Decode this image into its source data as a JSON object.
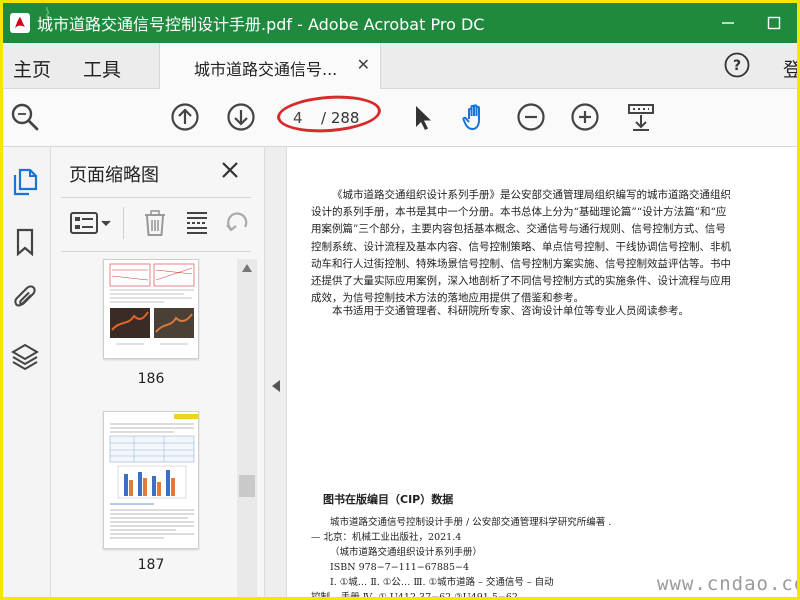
{
  "window": {
    "title": "城市道路交通信号控制设计手册.pdf - Adobe Acrobat Pro DC",
    "accent": "#1f8a3e"
  },
  "tabs": {
    "home": "主页",
    "tools": "工具",
    "document": "城市道路交通信号...",
    "login": "登"
  },
  "toolbar": {
    "page_current": "4",
    "page_total": "/ 288",
    "highlight_color": "#d52b2b"
  },
  "thumbnails": {
    "panel_title": "页面缩略图",
    "pages": [
      {
        "number": "186"
      },
      {
        "number": "187"
      }
    ]
  },
  "document": {
    "paragraph1": "《城市道路交通组织设计系列手册》是公安部交通管理局组织编写的城市道路交通组织设计的系列手册，本书是其中一个分册。本书总体上分为“基础理论篇”“设计方法篇”和“应用案例篇”三个部分，主要内容包括基本概念、交通信号与通行规则、信号控制方式、信号控制系统、设计流程及基本内容、信号控制策略、单点信号控制、干线协调信号控制、非机动车和行人过街控制、特殊场景信号控制、信号控制方案实施、信号控制效益评估等。书中还提供了大量实际应用案例，深入地剖析了不同信号控制方式的实施条件、设计流程与应用成效，为信号控制技术方法的落地应用提供了借鉴和参考。",
    "paragraph2": "本书适用于交通管理者、科研院所专家、咨询设计单位等专业人员阅读参考。",
    "cip_title": "图书在版编目（CIP）数据",
    "cip_lines": [
      "城市道路交通信号控制设计手册 / 公安部交通管理科学研究所编著 .",
      "— 北京：机械工业出版社，2021.4",
      "（城市道路交通组织设计系列手册）",
      "ISBN 978−7−111−67885−4"
    ],
    "cip_lines2": [
      "Ⅰ. ①城…   Ⅱ. ①公…   Ⅲ. ①城市道路 – 交通信号 – 自动",
      "控制 – 手册   Ⅳ. ① U412.37−62 ②U491.5−62"
    ]
  },
  "watermark": "www.cndao.com",
  "icons": {
    "titlebar": [
      "acrobat-logo-icon",
      "minimize-icon",
      "maximize-icon",
      "close-icon"
    ],
    "toolbar": [
      "zoom-search-icon",
      "previous-page-icon",
      "next-page-icon",
      "select-cursor-icon",
      "hand-tool-icon",
      "zoom-out-icon",
      "zoom-in-icon",
      "fit-page-icon"
    ],
    "rail": [
      "page-thumbnails-icon",
      "bookmarks-icon",
      "attachments-icon",
      "layers-icon"
    ]
  }
}
